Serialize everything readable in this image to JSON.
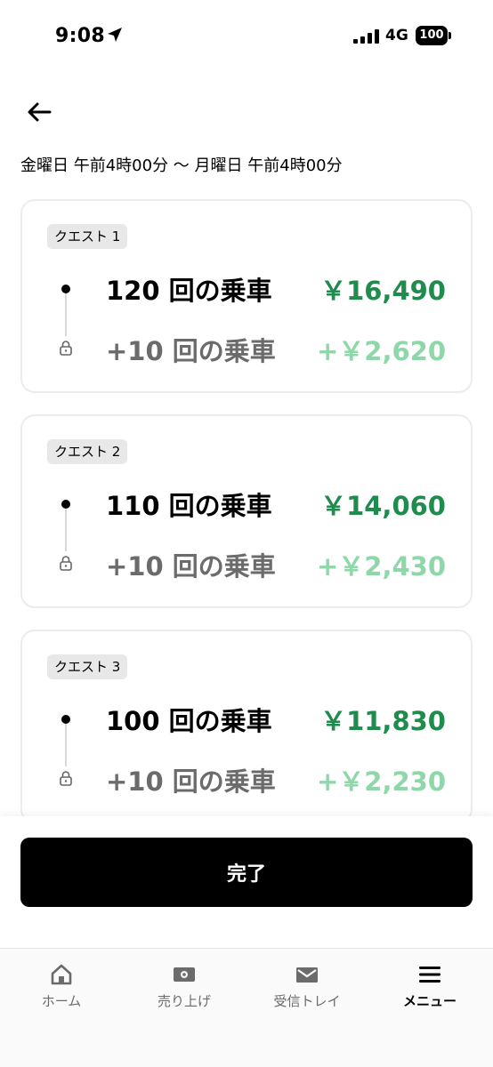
{
  "status_bar": {
    "time": "9:08",
    "network": "4G",
    "battery": "100"
  },
  "header": {
    "date_range": "金曜日 午前4時00分 〜 月曜日 午前4時00分"
  },
  "quests": [
    {
      "badge": "クエスト 1",
      "main_label": "120 回の乗車",
      "main_amount": "￥16,490",
      "bonus_label": "+10 回の乗車",
      "bonus_amount": "+￥2,620"
    },
    {
      "badge": "クエスト 2",
      "main_label": "110 回の乗車",
      "main_amount": "￥14,060",
      "bonus_label": "+10 回の乗車",
      "bonus_amount": "+￥2,430"
    },
    {
      "badge": "クエスト 3",
      "main_label": "100 回の乗車",
      "main_amount": "￥11,830",
      "bonus_label": "+10 回の乗車",
      "bonus_amount": "+￥2,230"
    }
  ],
  "done_button": {
    "label": "完了"
  },
  "tabs": [
    {
      "label": "ホーム",
      "icon": "home-icon"
    },
    {
      "label": "売り上げ",
      "icon": "earnings-icon"
    },
    {
      "label": "受信トレイ",
      "icon": "inbox-icon"
    },
    {
      "label": "メニュー",
      "icon": "menu-icon",
      "active": true
    }
  ],
  "colors": {
    "amount_green": "#1f8b4c",
    "bonus_green": "#8ed7a8",
    "accent": "#000000"
  }
}
